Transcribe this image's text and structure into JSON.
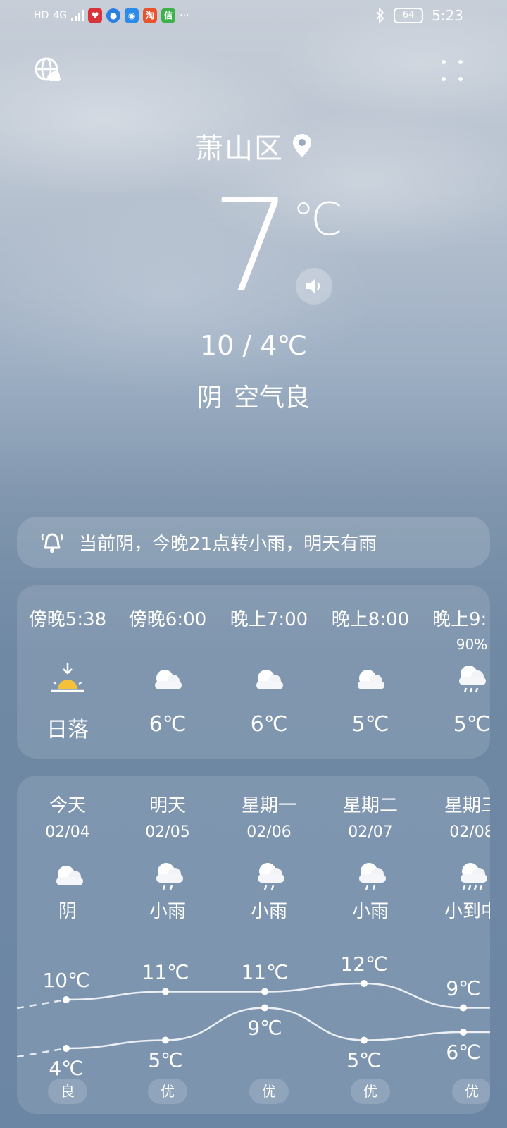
{
  "status_bar": {
    "left_badges": [
      "HD",
      "4G"
    ],
    "more": "···",
    "battery": "64",
    "time": "5:23"
  },
  "location": {
    "name": "萧山区"
  },
  "current": {
    "temperature": "7",
    "unit": "℃",
    "hi_lo": "10 / 4℃",
    "weather": "阴",
    "air_quality": "空气良"
  },
  "alert": {
    "text": "当前阴，今晚21点转小雨，明天有雨"
  },
  "hourly": [
    {
      "time": "傍晚5:38",
      "pop": "",
      "icon": "sunset-icon",
      "temp": "日落"
    },
    {
      "time": "傍晚6:00",
      "pop": "",
      "icon": "cloud-icon",
      "temp": "6℃"
    },
    {
      "time": "晚上7:00",
      "pop": "",
      "icon": "cloud-icon",
      "temp": "6℃"
    },
    {
      "time": "晚上8:00",
      "pop": "",
      "icon": "cloud-icon",
      "temp": "5℃"
    },
    {
      "time": "晚上9:",
      "pop": "90%",
      "icon": "rain-cloud-icon",
      "temp": "5℃"
    }
  ],
  "daily": [
    {
      "day": "今天",
      "date": "02/04",
      "icon": "cloud-icon",
      "cond": "阴",
      "high": 10,
      "low": 4,
      "high_label": "10℃",
      "low_label": "4℃",
      "aqi": "良"
    },
    {
      "day": "明天",
      "date": "02/05",
      "icon": "rain-cloud-icon",
      "cond": "小雨",
      "high": 11,
      "low": 5,
      "high_label": "11℃",
      "low_label": "5℃",
      "aqi": "优"
    },
    {
      "day": "星期一",
      "date": "02/06",
      "icon": "rain-cloud-icon",
      "cond": "小雨",
      "high": 11,
      "low": 9,
      "high_label": "11℃",
      "low_label": "9℃",
      "aqi": "优"
    },
    {
      "day": "星期二",
      "date": "02/07",
      "icon": "rain-cloud-icon",
      "cond": "小雨",
      "high": 12,
      "low": 5,
      "high_label": "12℃",
      "low_label": "5℃",
      "aqi": "优"
    },
    {
      "day": "星期三",
      "date": "02/08",
      "icon": "heavy-rain-cloud-icon",
      "cond": "小到中",
      "high": 9,
      "low": 6,
      "high_label": "9℃",
      "low_label": "6℃",
      "aqi": "优"
    }
  ]
}
